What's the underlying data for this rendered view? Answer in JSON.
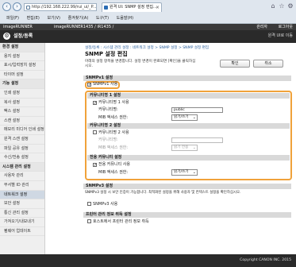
{
  "browser": {
    "address": "http://192.168.222.99/rui_ui/_P...",
    "tab_title": "원격 UI: SNMP 설정 편집...",
    "menu": [
      "파일(F)",
      "편집(E)",
      "보기(V)",
      "즐겨찾기(A)",
      "도구(T)",
      "도움말(H)"
    ]
  },
  "app": {
    "device_name": "imageRUNNER",
    "device_model": "imageRUNNER1435 / iR1435 /",
    "title": "설정/등록",
    "login_user": "관리자",
    "logout_label": "로그아웃",
    "portal_label": "원격 UI로 이동"
  },
  "sidebar": {
    "items": [
      {
        "label": "환경 설정",
        "type": "header"
      },
      {
        "label": "용지 설정",
        "type": "item"
      },
      {
        "label": "표시/입력장치 설정",
        "type": "item"
      },
      {
        "label": "타이머 설정",
        "type": "item"
      },
      {
        "label": "기능 설정",
        "type": "header"
      },
      {
        "label": "인쇄 설정",
        "type": "item"
      },
      {
        "label": "복사 설정",
        "type": "item"
      },
      {
        "label": "팩스 설정",
        "type": "item"
      },
      {
        "label": "스캔 설정",
        "type": "item"
      },
      {
        "label": "메모리 미디어 인쇄 설정",
        "type": "item"
      },
      {
        "label": "원격 스캔 설정",
        "type": "item"
      },
      {
        "label": "파일 공유 설정",
        "type": "item"
      },
      {
        "label": "수신/전송 설정",
        "type": "item"
      },
      {
        "label": "시스템 관리 설정",
        "type": "header"
      },
      {
        "label": "사용자 관리",
        "type": "item"
      },
      {
        "label": "부서별 ID 관리",
        "type": "item"
      },
      {
        "label": "네트워크 설정",
        "type": "selected"
      },
      {
        "label": "보안 설정",
        "type": "item"
      },
      {
        "label": "통신 관리 설정",
        "type": "item"
      },
      {
        "label": "가져오기/내보내기",
        "type": "item"
      },
      {
        "label": "펌웨어 업데이트",
        "type": "item"
      }
    ]
  },
  "main": {
    "breadcrumb": "설정/등록 : 시스템 관리 설정 : 네트워크 설정 > SNMP 설정 > SNMP 설정 편집",
    "title": "SNMP 설정 편집",
    "description": "아래의 설정 항목을 변경합니다. 설정 변경이 완료되면 [확인]을 클릭하십시오.",
    "ok_label": "확인",
    "cancel_label": "취소",
    "v1_section": "SNMPv1 설정",
    "v1_use_label": "SNMPv1 사용",
    "v1_use_checked": "✓",
    "community1_header": "커뮤니티명 1 설정",
    "community1_use_label": "커뮤니티명 1 사용",
    "community1_use_checked": "✓",
    "community_name_label": "커뮤니티명:",
    "community1_value": "public",
    "mib_access_label": "MIB 액세스 권한:",
    "community1_mib": "읽기/쓰기",
    "community2_header": "커뮤니티명 2 설정",
    "community2_use_label": "커뮤니티명 2 사용",
    "community2_value": "",
    "community2_mib": "읽기 전용",
    "dedicated_header": "전용 커뮤니티 설정",
    "dedicated_use_label": "전용 커뮤니티 사용",
    "dedicated_use_checked": "✓",
    "dedicated_mib": "읽기/쓰기",
    "v3_section": "SNMPv3 설정",
    "v3_desc": "SNMPv3 설정 시 보안 인증이 가능합니다. 최적화된 설정을 위해 사용자 및 컨텍스트 설정을 확인하십시오.",
    "v3_use_label": "SNMPv3 사용",
    "printer_mgmt_section": "프린터 관리 정보 취득 설정",
    "printer_mgmt_label": "호스트에서 프린터 관리 정보 취득"
  },
  "footer": {
    "copyright": "Copyright CANON INC. 2015"
  }
}
